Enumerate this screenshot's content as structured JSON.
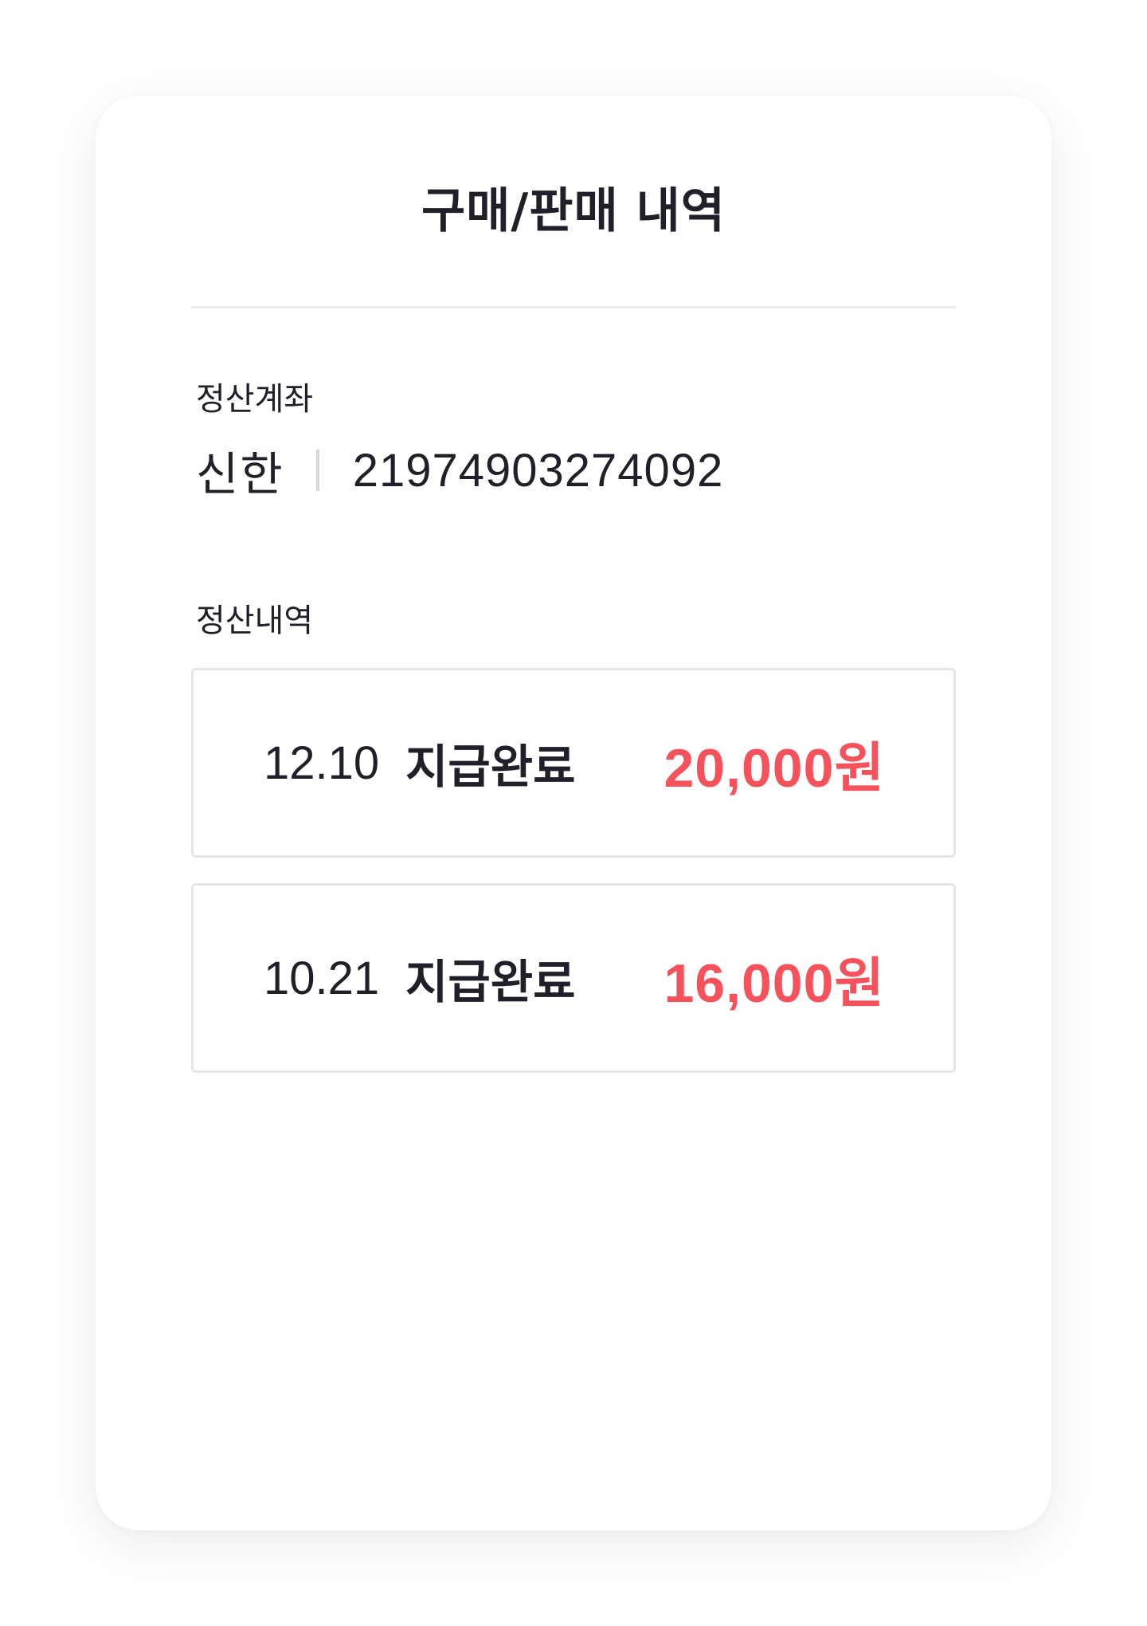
{
  "header": {
    "title": "구매/판매 내역"
  },
  "account": {
    "label": "정산계좌",
    "bank": "신한",
    "number": "21974903274092"
  },
  "history": {
    "label": "정산내역",
    "items": [
      {
        "date": "12.10",
        "status": "지급완료",
        "amount": "20,000원"
      },
      {
        "date": "10.21",
        "status": "지급완료",
        "amount": "16,000원"
      }
    ]
  },
  "colors": {
    "accent": "#f5525c",
    "text": "#1f2029",
    "border": "#e6e6e6",
    "divider": "#ebebeb"
  }
}
